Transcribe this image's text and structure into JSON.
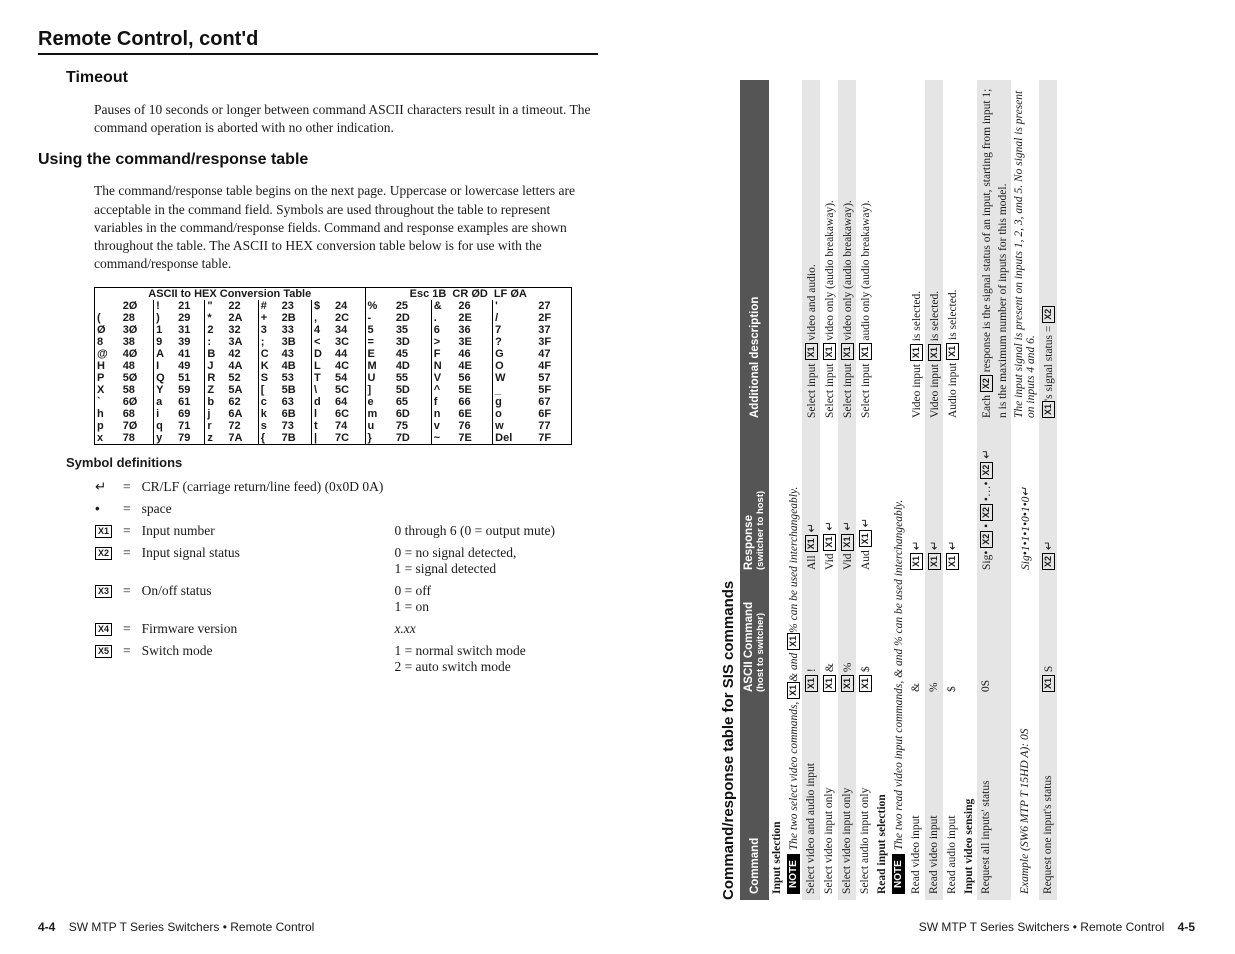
{
  "left": {
    "title": "Remote Control, cont'd",
    "timeout_h": "Timeout",
    "timeout_p": "Pauses of 10 seconds or longer between command ASCII characters result in a timeout.  The command operation is aborted with no other indication.",
    "use_h": "Using the command/response table",
    "use_p": "The command/response table begins on the next page.  Uppercase or lowercase letters are acceptable in the command field.  Symbols are used throughout the table to represent variables in the command/response fields.  Command and response examples are shown throughout the table.  The ASCII to HEX conversion table below is for use with the command/response table.",
    "hex_title": "ASCII to HEX  Conversion Table",
    "hex_extra": "Esc 1B|CR ØD|LF ØA",
    "hex_rows": [
      [
        "",
        "2Ø",
        "!",
        "21",
        "\"",
        "22",
        "#",
        "23",
        "$",
        "24",
        "%",
        "25",
        "&",
        "26",
        "'",
        "27"
      ],
      [
        "(",
        "28",
        ")",
        "29",
        "*",
        "2A",
        "+",
        "2B",
        ",",
        "2C",
        "-",
        "2D",
        ".",
        "2E",
        "/",
        "2F"
      ],
      [
        "Ø",
        "3Ø",
        "1",
        "31",
        "2",
        "32",
        "3",
        "33",
        "4",
        "34",
        "5",
        "35",
        "6",
        "36",
        "7",
        "37"
      ],
      [
        "8",
        "38",
        "9",
        "39",
        ":",
        "3A",
        ";",
        "3B",
        "<",
        "3C",
        "=",
        "3D",
        ">",
        "3E",
        "?",
        "3F"
      ],
      [
        "@",
        "4Ø",
        "A",
        "41",
        "B",
        "42",
        "C",
        "43",
        "D",
        "44",
        "E",
        "45",
        "F",
        "46",
        "G",
        "47"
      ],
      [
        "H",
        "48",
        "I",
        "49",
        "J",
        "4A",
        "K",
        "4B",
        "L",
        "4C",
        "M",
        "4D",
        "N",
        "4E",
        "O",
        "4F"
      ],
      [
        "P",
        "5Ø",
        "Q",
        "51",
        "R",
        "52",
        "S",
        "53",
        "T",
        "54",
        "U",
        "55",
        "V",
        "56",
        "W",
        "57"
      ],
      [
        "X",
        "58",
        "Y",
        "59",
        "Z",
        "5A",
        "[",
        "5B",
        "\\",
        "5C",
        "]",
        "5D",
        "^",
        "5E",
        "_",
        "5F"
      ],
      [
        "`",
        "6Ø",
        "a",
        "61",
        "b",
        "62",
        "c",
        "63",
        "d",
        "64",
        "e",
        "65",
        "f",
        "66",
        "g",
        "67"
      ],
      [
        "h",
        "68",
        "i",
        "69",
        "j",
        "6A",
        "k",
        "6B",
        "l",
        "6C",
        "m",
        "6D",
        "n",
        "6E",
        "o",
        "6F"
      ],
      [
        "p",
        "7Ø",
        "q",
        "71",
        "r",
        "72",
        "s",
        "73",
        "t",
        "74",
        "u",
        "75",
        "v",
        "76",
        "w",
        "77"
      ],
      [
        "x",
        "78",
        "y",
        "79",
        "z",
        "7A",
        "{",
        "7B",
        "|",
        "7C",
        "}",
        "7D",
        "~",
        "7E",
        "Del",
        "7F"
      ]
    ],
    "sym_h": "Symbol definitions",
    "symbols": [
      {
        "s": "↵",
        "d": "CR/LF (carriage return/line feed) (0x0D 0A)",
        "v": ""
      },
      {
        "s": "•",
        "d": "space",
        "v": ""
      },
      {
        "s": "X1",
        "box": true,
        "d": "Input number",
        "v": "0 through 6 (0 = output mute)"
      },
      {
        "s": "X2",
        "box": true,
        "d": "Input signal status",
        "v": "0 = no signal detected,\n1 = signal detected"
      },
      {
        "s": "X3",
        "box": true,
        "d": "On/off status",
        "v": "0 = off\n1 = on"
      },
      {
        "s": "X4",
        "box": true,
        "d": "Firmware version",
        "v": "x.xx",
        "ital": true
      },
      {
        "s": "X5",
        "box": true,
        "d": "Switch mode",
        "v": "1 = normal switch mode\n2 = auto switch mode"
      }
    ],
    "footer_pg": "4-4",
    "footer_txt": "SW MTP T Series Switchers • Remote Control"
  },
  "right": {
    "title": "Command/response table for SIS commands",
    "head": [
      "Command",
      "ASCII Command",
      "Response",
      "Additional description"
    ],
    "sub": [
      "",
      "(host to switcher)",
      "(switcher to host)",
      ""
    ],
    "groups": [
      {
        "section": "Input selection",
        "note": "The two select video commands, X1& and X1% can be used interchangeably.",
        "rows": [
          {
            "shade": true,
            "c": [
              "Select video and audio input",
              "X1 !",
              "All X1 ↵",
              "Select input X1 video and audio."
            ]
          },
          {
            "c": [
              "Select video input only",
              "X1 &",
              "Vid X1 ↵",
              "Select input X1 video only (audio breakaway)."
            ]
          },
          {
            "shade": true,
            "c": [
              "Select video input only",
              "X1 %",
              "Vid X1 ↵",
              "Select input X1 video only (audio breakaway)."
            ]
          },
          {
            "c": [
              "Select audio input only",
              "X1 $",
              "Aud X1 ↵",
              "Select input X1 audio only (audio breakaway)."
            ]
          }
        ]
      },
      {
        "section": "Read input selection",
        "note": "The two read video input commands, & and % can be used interchangeably.",
        "rows": [
          {
            "c": [
              "Read video input",
              "&",
              "X1 ↵",
              "Video input X1 is selected."
            ]
          },
          {
            "shade": true,
            "c": [
              "Read video input",
              "%",
              "X1 ↵",
              "Video input X1 is selected."
            ]
          },
          {
            "c": [
              "Read audio input",
              "$",
              "X1 ↵",
              "Audio input X1 is selected."
            ]
          }
        ]
      },
      {
        "section": "Input video sensing",
        "rows": [
          {
            "shade": true,
            "c": [
              "Request all inputs' status",
              "0S",
              "Sig• X2 • X2 •…• X2 ↵",
              "Each X2 response is the signal status of an input, starting from input 1;"
            ]
          },
          {
            "shade": true,
            "c": [
              "",
              "",
              "",
              "n is the maximum number of inputs for this model."
            ]
          },
          {
            "c": [
              "Example (SW6 MTP T 15HD A):  0S",
              "",
              "Sig•1•1•1•0•1•0↵",
              "The input signal is present on inputs 1, 2, 3, and 5. No signal is present on inputs 4 and 6."
            ],
            "ital": true
          },
          {
            "shade": true,
            "c": [
              "Request one input's status",
              "X1 S",
              "X2 ↵",
              "X1's signal status = X2"
            ]
          }
        ]
      }
    ],
    "footer_txt": "SW MTP T Series Switchers • Remote Control",
    "footer_pg": "4-5"
  }
}
